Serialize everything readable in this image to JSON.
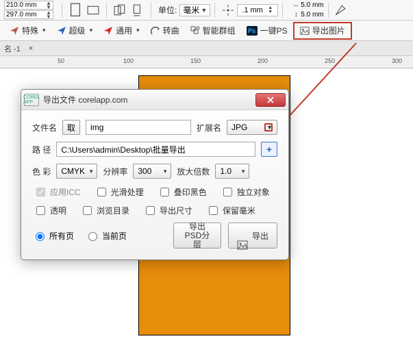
{
  "toolbar1": {
    "width_val": "210.0 mm",
    "height_val": "297.0 mm",
    "units_label": "单位:",
    "units_value": "毫米",
    "nudge_label": "",
    "nudge_value": ".1 mm",
    "dup_x": "5.0 mm",
    "dup_y": "5.0 mm"
  },
  "toolbar2": {
    "special": "特殊",
    "super": "超级",
    "common": "通用",
    "tocurve": "转曲",
    "smartgroup": "智能群组",
    "ps": "Ps",
    "oneclick": "一键PS",
    "export": "导出图片"
  },
  "bar3": {
    "label": "名 -1"
  },
  "ruler": [
    "50",
    "100",
    "150",
    "200",
    "250",
    "300"
  ],
  "orange": {},
  "dialog": {
    "title": "导出文件 corelapp.com",
    "logo": "COREL APP",
    "filename_label": "文件名",
    "get_btn": "取",
    "filename_value": "img",
    "ext_label": "扩展名",
    "ext_value": "JPG",
    "path_label": "路  径",
    "path_value": "C:\\Users\\admin\\Desktop\\批量导出",
    "plus": "+",
    "color_label": "色 彩",
    "color_value": "CMYK",
    "res_label": "分辨率",
    "res_value": "300",
    "zoom_label": "放大倍数",
    "zoom_value": "1.0",
    "chk_icc": "应用ICC",
    "chk_smooth": "光滑处理",
    "chk_overprint": "叠印黑色",
    "chk_separate": "独立对象",
    "chk_transparent": "透明",
    "chk_browse": "浏览目录",
    "chk_exportsize": "导出尺寸",
    "chk_keepmm": "保留毫米",
    "radio_all": "所有页",
    "radio_current": "当前页",
    "btn_psd": "导出\nPSD分层",
    "btn_export": "导出"
  }
}
